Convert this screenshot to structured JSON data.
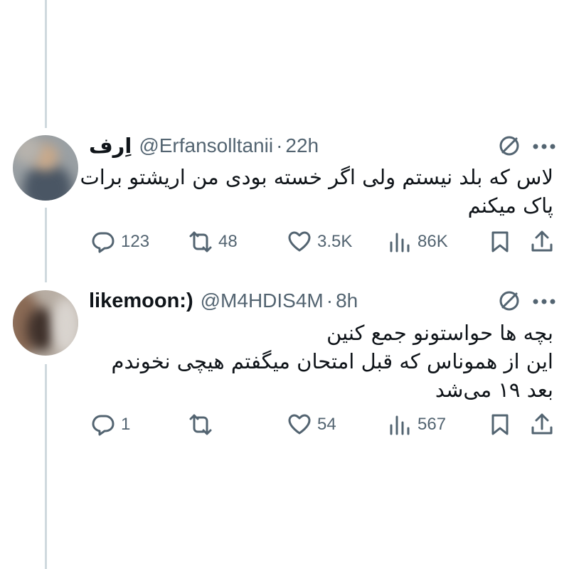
{
  "tweets": [
    {
      "name": "اِرف",
      "handle": "@Erfansolltanii",
      "time": "22h",
      "text_lines": [
        "لاس که بلد نیستم ولی اگر خسته بودی من اریشتو برات",
        "پاک میکنم"
      ],
      "replies": "123",
      "retweets": "48",
      "likes": "3.5K",
      "views": "86K"
    },
    {
      "name": "likemoon:)",
      "handle": "@M4HDIS4M",
      "time": "8h",
      "text_lines": [
        "بچه ها حواستونو جمع کنین",
        "این از هموناس که قبل امتحان میگفتم هیچی نخوندم",
        "بعد ۱۹ می‌شد"
      ],
      "replies": "1",
      "retweets": "",
      "likes": "54",
      "views": "567"
    }
  ],
  "separator": "·",
  "colors": {
    "text": "#0f1419",
    "secondary": "#536471",
    "thread_line": "#cfd9de"
  },
  "icons": [
    "reply-icon",
    "retweet-icon",
    "like-icon",
    "views-icon",
    "bookmark-icon",
    "share-icon",
    "more-icon",
    "not-allowed-icon"
  ]
}
